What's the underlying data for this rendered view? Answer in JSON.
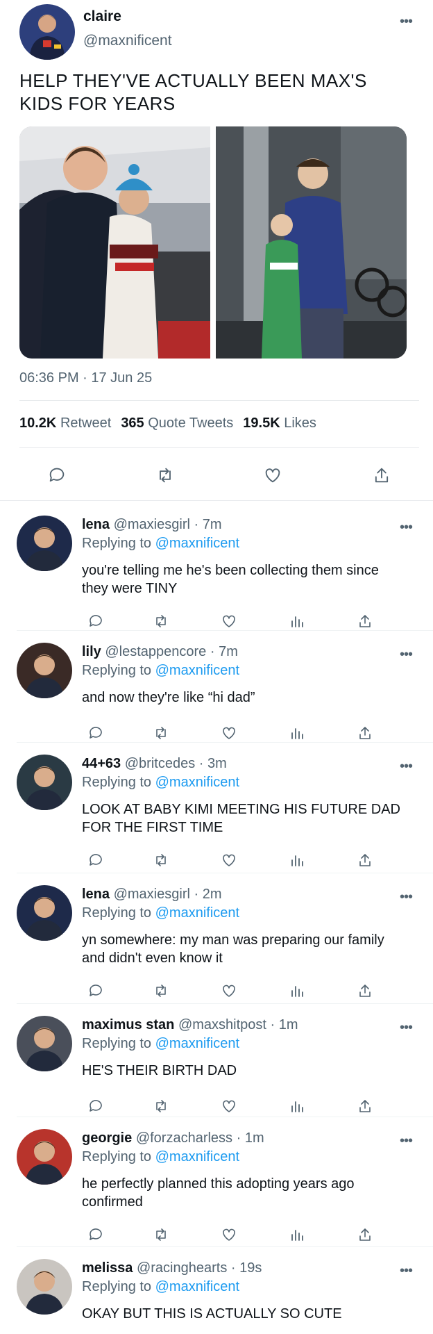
{
  "tweet": {
    "name": "claire",
    "handle": "@maxnificent",
    "more_label": "•••",
    "text": "HELP THEY'VE ACTUALLY BEEN MAX'S KIDS FOR YEARS",
    "timestamp": "06:36 PM · 17 Jun 25",
    "stats": {
      "retweets_count": "10.2K",
      "retweets_label": "Retweet",
      "quotes_count": "365",
      "quotes_label": "Quote Tweets",
      "likes_count": "19.5K",
      "likes_label": "Likes"
    },
    "photos": [
      "photo-karting-paddock",
      "photo-garage-kid"
    ],
    "actions": [
      "reply-icon",
      "retweet-icon",
      "like-icon",
      "share-icon"
    ]
  },
  "replies": [
    {
      "name": "lena",
      "handle": "@maxiesgirl",
      "time": "· 7m",
      "replying_prefix": "Replying to",
      "replying_to": "@maxnificent",
      "text": "you're telling me he's been collecting them since they were TINY",
      "more": "•••",
      "avatar_color": "#1e2a4a"
    },
    {
      "name": "lily",
      "handle": "@lestappencore",
      "time": "· 7m",
      "replying_prefix": "Replying to",
      "replying_to": "@maxnificent",
      "text": "and now they're like “hi dad”",
      "more": "•••",
      "avatar_color": "#3a2a26"
    },
    {
      "name": "44+63",
      "handle": "@britcedes",
      "time": "· 3m",
      "replying_prefix": "Replying to",
      "replying_to": "@maxnificent",
      "text": "LOOK AT BABY KIMI MEETING HIS FUTURE DAD FOR THE FIRST TIME",
      "more": "•••",
      "avatar_color": "#2a3a44"
    },
    {
      "name": "lena",
      "handle": "@maxiesgirl",
      "time": "· 2m",
      "replying_prefix": "Replying to",
      "replying_to": "@maxnificent",
      "text": "yn somewhere: my man was preparing our family and didn't even know it",
      "more": "•••",
      "avatar_color": "#1e2a4a"
    },
    {
      "name": "maximus stan",
      "handle": "@maxshitpost",
      "time": "· 1m",
      "replying_prefix": "Replying to",
      "replying_to": "@maxnificent",
      "text": "HE'S THEIR BIRTH DAD",
      "more": "•••",
      "avatar_color": "#4a4f5a"
    },
    {
      "name": "georgie",
      "handle": "@forzacharless",
      "time": "· 1m",
      "replying_prefix": "Replying to",
      "replying_to": "@maxnificent",
      "text": "he perfectly planned this adopting years ago confirmed",
      "more": "•••",
      "avatar_color": "#b8342c"
    },
    {
      "name": "melissa",
      "handle": "@racinghearts",
      "time": "· 19s",
      "replying_prefix": "Replying to",
      "replying_to": "@maxnificent",
      "text": "OKAY BUT THIS IS ACTUALLY SO CUTE",
      "more": "•••",
      "avatar_color": "#c9c5c0"
    }
  ],
  "colors": {
    "text": "#0f1419",
    "secondary": "#536471",
    "link": "#1d9bf0",
    "divider": "#e6e9ec"
  }
}
